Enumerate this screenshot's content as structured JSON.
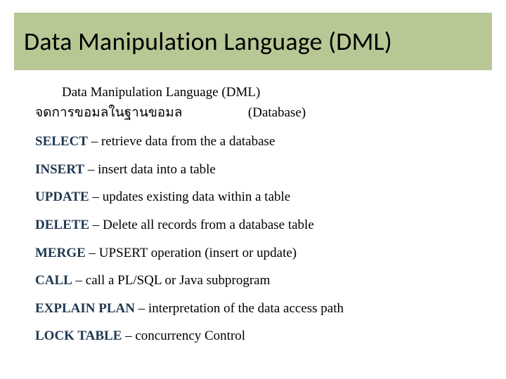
{
  "title": "Data Manipulation Language  (DML)",
  "intro": {
    "line1": "Data Manipulation Language  (DML)",
    "thai_prefix": "จดการขอมลในฐานขอมล",
    "db_label": "(Database)"
  },
  "items": [
    {
      "keyword": "SELECT",
      "desc": " – retrieve data from the a database"
    },
    {
      "keyword": "INSERT",
      "desc": " – insert data into a table"
    },
    {
      "keyword": "UPDATE",
      "desc": " – updates existing data within a table"
    },
    {
      "keyword": "DELETE",
      "desc": " – Delete all records from a database table"
    },
    {
      "keyword": "MERGE",
      "desc": " – UPSERT operation (insert or update)"
    },
    {
      "keyword": "CALL",
      "desc": " – call a PL/SQL or Java subprogram"
    },
    {
      "keyword": "EXPLAIN PLAN",
      "desc": " – interpretation of the data access path"
    },
    {
      "keyword": "LOCK TABLE",
      "desc": " – concurrency Control"
    }
  ]
}
